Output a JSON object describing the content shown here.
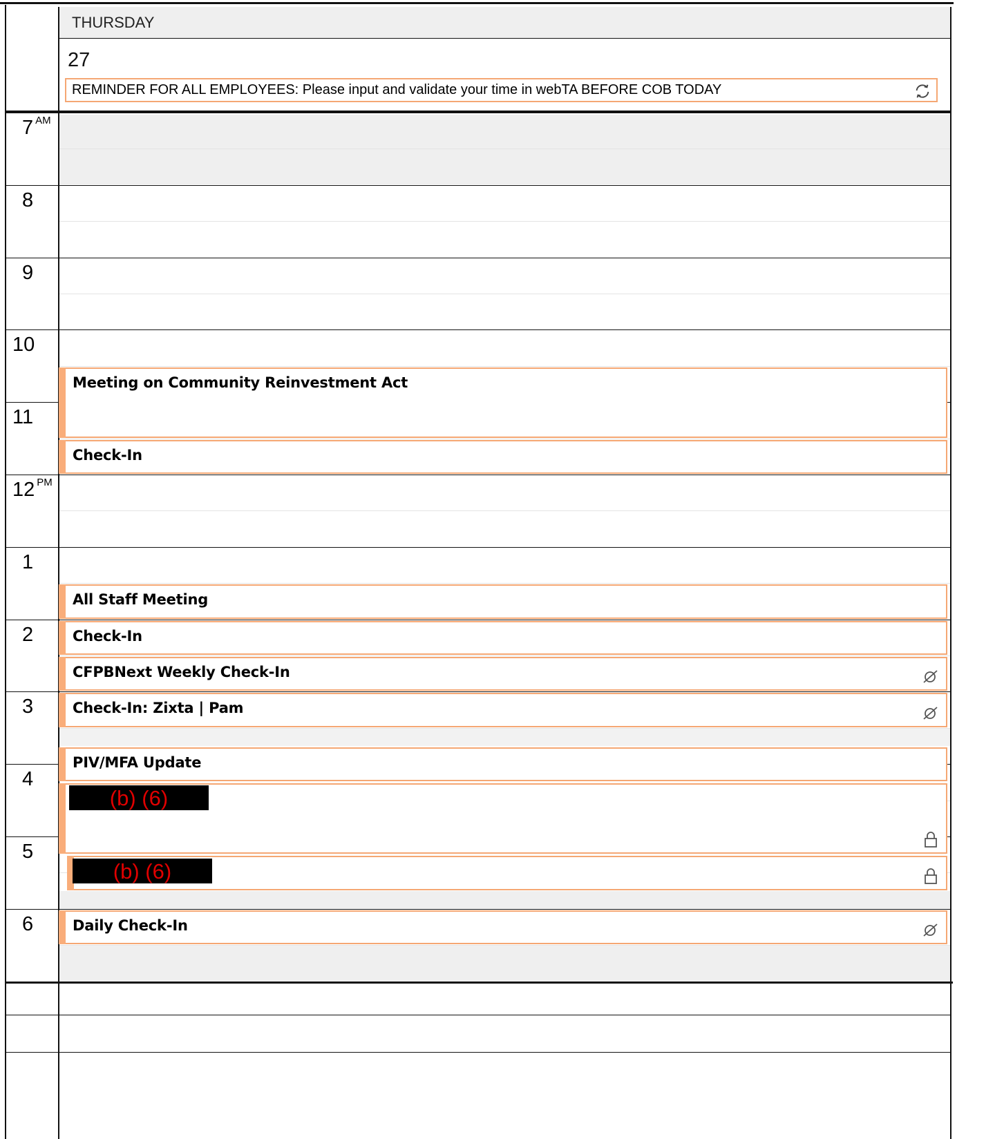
{
  "day": {
    "weekday": "THURSDAY",
    "date": "27"
  },
  "all_day_event": {
    "title": "REMINDER FOR ALL EMPLOYEES: Please input and validate your time in webTA BEFORE COB TODAY",
    "icon": "recurring-icon"
  },
  "hours": [
    {
      "label": "7",
      "suffix": "AM"
    },
    {
      "label": "8",
      "suffix": ""
    },
    {
      "label": "9",
      "suffix": ""
    },
    {
      "label": "10",
      "suffix": ""
    },
    {
      "label": "11",
      "suffix": ""
    },
    {
      "label": "12",
      "suffix": "PM"
    },
    {
      "label": "1",
      "suffix": ""
    },
    {
      "label": "2",
      "suffix": ""
    },
    {
      "label": "3",
      "suffix": ""
    },
    {
      "label": "4",
      "suffix": ""
    },
    {
      "label": "5",
      "suffix": ""
    },
    {
      "label": "6",
      "suffix": ""
    }
  ],
  "events": [
    {
      "title": "Meeting on Community Reinvestment Act",
      "start": "10:30",
      "end": "11:30",
      "icon": ""
    },
    {
      "title": "Check-In",
      "start": "11:30",
      "end": "12:00",
      "icon": ""
    },
    {
      "title": "All Staff Meeting",
      "start": "1:30",
      "end": "2:00",
      "icon": ""
    },
    {
      "title": "Check-In",
      "start": "2:00",
      "end": "2:30",
      "icon": ""
    },
    {
      "title": "CFPBNext Weekly Check-In",
      "start": "2:30",
      "end": "3:00",
      "icon": "no-reminder-icon"
    },
    {
      "title": "Check-In: Zixta | Pam",
      "start": "3:00",
      "end": "3:30",
      "icon": "no-reminder-icon"
    },
    {
      "title": "PIV/MFA Update",
      "start": "3:45",
      "end": "4:15",
      "icon": ""
    },
    {
      "title": "(b) (6)",
      "start": "4:15",
      "end": "5:15",
      "icon": "lock-icon",
      "redacted": true
    },
    {
      "title": "(b) (6)",
      "start": "5:15",
      "end": "5:45",
      "icon": "lock-icon",
      "redacted": true
    },
    {
      "title": "Daily Check-In",
      "start": "6:00",
      "end": "6:30",
      "icon": "no-reminder-icon"
    }
  ]
}
